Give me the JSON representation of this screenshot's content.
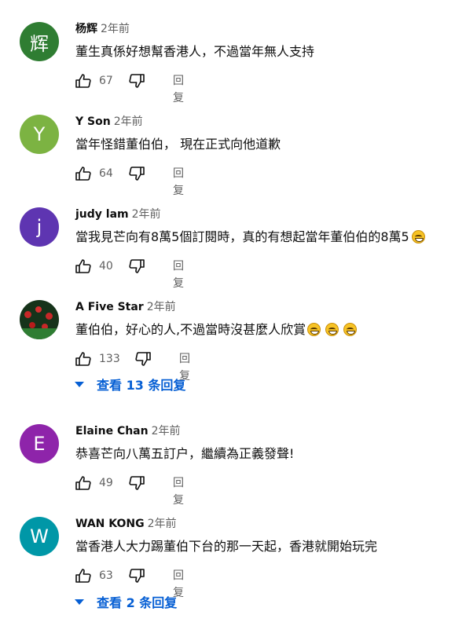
{
  "comments": [
    {
      "author": "杨辉",
      "time": "2年前",
      "avatar_letter": "辉",
      "avatar_color": "#2f7d32",
      "text": "董生真係好想幫香港人，不過當年無人支持",
      "likes": "67",
      "reply_label": "回复"
    },
    {
      "author": "Y Son",
      "time": "2年前",
      "avatar_letter": "Y",
      "avatar_color": "#7cb342",
      "text": "當年怪錯董伯伯， 現在正式向他道歉",
      "likes": "64",
      "reply_label": "回复"
    },
    {
      "author": "judy lam",
      "time": "2年前",
      "avatar_letter": "j",
      "avatar_color": "#5e35b1",
      "text": "當我見芒向有8萬5個訂閱時，真的有想起當年董伯伯的8萬5",
      "emoji": "grinning-sweat-emoji",
      "likes": "40",
      "reply_label": "回复"
    },
    {
      "author": "A Five Star",
      "time": "2年前",
      "avatar_letter": "",
      "avatar_color": "#1b3a1b",
      "text": "董伯伯，好心的人,不過當時沒甚麼人欣賞",
      "emoji_count": 3,
      "emoji": "grinning-sweat-emoji",
      "likes": "133",
      "reply_label": "回复",
      "replies_label": "查看 13 条回复"
    },
    {
      "author": "Elaine Chan",
      "time": "2年前",
      "avatar_letter": "E",
      "avatar_color": "#8e24aa",
      "text": "恭喜芒向八萬五訂户，繼續為正義發聲!",
      "likes": "49",
      "reply_label": "回复"
    },
    {
      "author": "WAN KONG",
      "time": "2年前",
      "avatar_letter": "W",
      "avatar_color": "#0097a7",
      "text": "當香港人大力踢董伯下台的那一天起，香港就開始玩完",
      "likes": "63",
      "reply_label": "回复",
      "replies_label": "查看 2 条回复"
    }
  ],
  "icons": {
    "like": "thumb-up-icon",
    "dislike": "thumb-down-icon",
    "expand": "caret-down-icon"
  }
}
